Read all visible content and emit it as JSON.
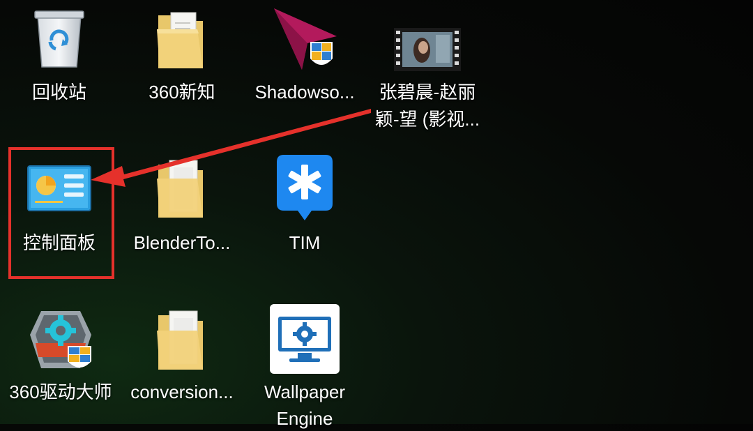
{
  "desktop": {
    "icons": [
      {
        "label": "回收站",
        "icon": "recycle-bin-icon"
      },
      {
        "label": "360新知",
        "icon": "folder-icon"
      },
      {
        "label": "Shadowso...",
        "icon": "shadowsocks-icon"
      },
      {
        "label": "张碧晨-赵丽颖-望 (影视...",
        "icon": "video-file-icon"
      },
      {
        "label": "控制面板",
        "icon": "control-panel-icon"
      },
      {
        "label": "BlenderTo...",
        "icon": "folder-icon"
      },
      {
        "label": "TIM",
        "icon": "tim-icon"
      },
      {
        "label": "360驱动大师",
        "icon": "driver-master-icon"
      },
      {
        "label": "conversion...",
        "icon": "folder-icon"
      },
      {
        "label": "Wallpaper Engine",
        "icon": "wallpaper-engine-icon"
      }
    ],
    "label_line1": "张碧晨-赵丽",
    "label_line2": "颖-望 (影视...",
    "wallpaper_label_line1": "Wallpaper",
    "wallpaper_label_line2": "Engine"
  },
  "annotation": {
    "highlight_color": "#e5312b",
    "arrow_color": "#e5312b",
    "target": "控制面板"
  }
}
